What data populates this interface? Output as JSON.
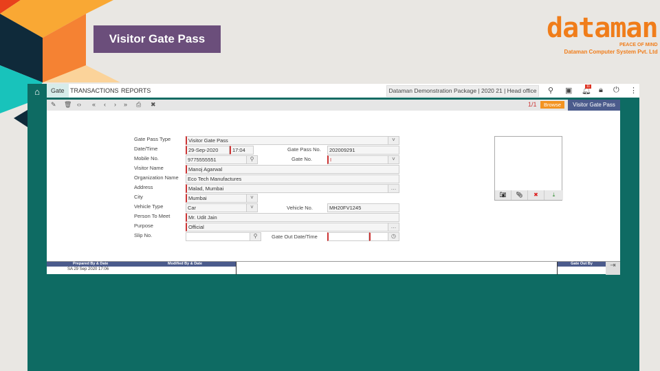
{
  "slide": {
    "title": "Visitor Gate Pass"
  },
  "logo": {
    "brand": "dataman",
    "tagline": "PEACE OF MIND",
    "company": "Dataman Computer System Pvt. Ltd"
  },
  "topbar": {
    "menus": [
      "Gate",
      "TRANSACTIONS",
      "REPORTS"
    ],
    "company": "Dataman Demonstration Package | 2020 21 | Head office",
    "notifications": "11"
  },
  "toolbar": {
    "record": "1/1",
    "mode": "Browse",
    "screen": "Visitor Gate Pass"
  },
  "form": {
    "gate_pass_type": {
      "label": "Gate Pass Type",
      "value": "Visitor Gate Pass"
    },
    "date_time": {
      "label": "Date/Time",
      "date": "29-Sep-2020",
      "time": "17:04"
    },
    "gate_pass_no": {
      "label": "Gate Pass No.",
      "value": "202009291"
    },
    "mobile": {
      "label": "Mobile No.",
      "value": "9775555551"
    },
    "gate_no": {
      "label": "Gate No.",
      "value": "I"
    },
    "visitor_name": {
      "label": "Visitor Name",
      "value": "Manoj Agarwal"
    },
    "organization": {
      "label": "Organization Name",
      "value": "Eco Tech Manufactures"
    },
    "address": {
      "label": "Address",
      "value": "Malad, Mumbai"
    },
    "city": {
      "label": "City",
      "value": "Mumbai"
    },
    "vehicle_type": {
      "label": "Vehicle Type",
      "value": "Car"
    },
    "vehicle_no": {
      "label": "Vehicle No.",
      "value": "MH20FV1245"
    },
    "person_to_meet": {
      "label": "Person To Meet",
      "value": "Mr. Udit Jain"
    },
    "purpose": {
      "label": "Purpose",
      "value": "Official"
    },
    "slip_no": {
      "label": "Slip No.",
      "value": ""
    },
    "gate_out": {
      "label": "Gate Out Date/Time",
      "value": ""
    }
  },
  "footer": {
    "prepared_label": "Prepared By & Date",
    "prepared_value": "SA   29 Sep 2020  17:06",
    "modified_label": "Modified By & Date",
    "gate_out_label": "Gate Out By"
  }
}
